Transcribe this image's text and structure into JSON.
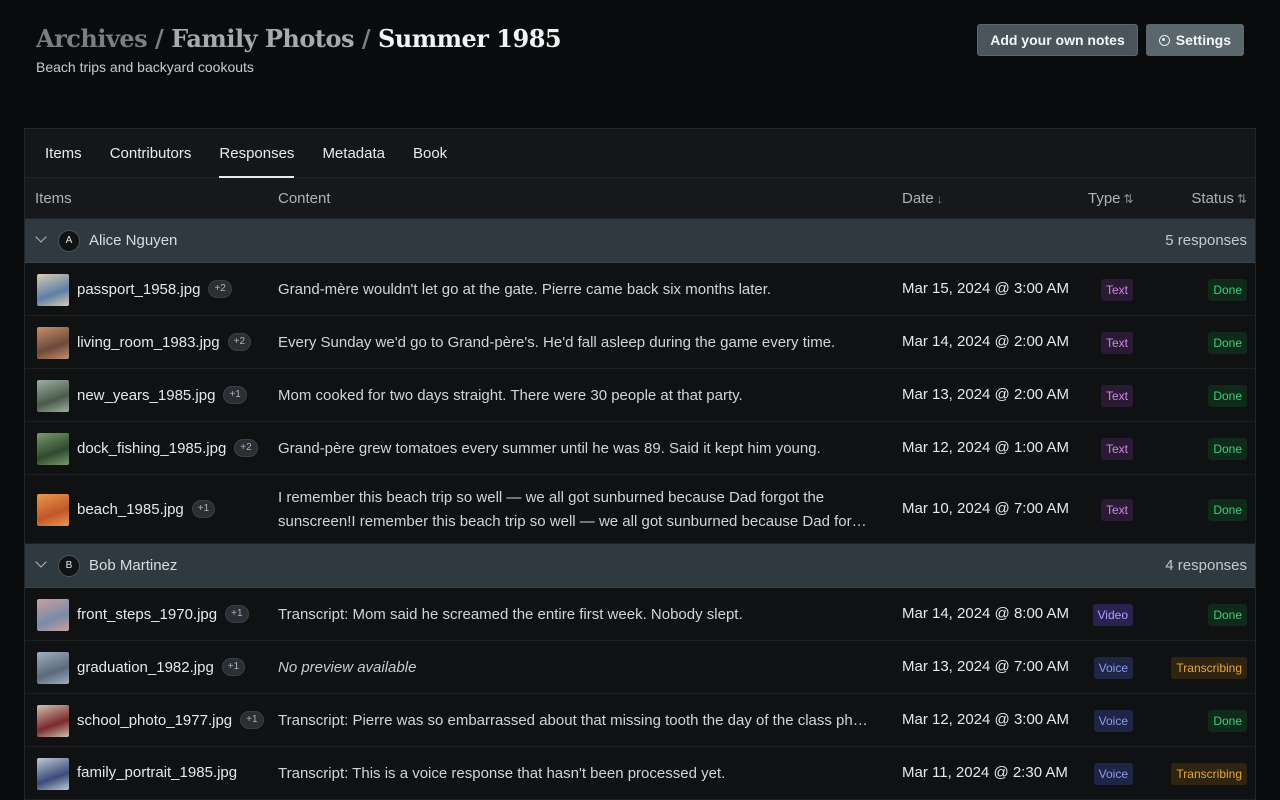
{
  "breadcrumb": {
    "part1": "Archives",
    "part2": "Family Photos",
    "current": "Summer 1985",
    "separator": "/"
  },
  "subtitle": "Beach trips and backyard cookouts",
  "actions": {
    "notes": "Add your own notes",
    "settings": "Settings"
  },
  "tabs": [
    "Items",
    "Contributors",
    "Responses",
    "Metadata",
    "Book"
  ],
  "active_tab": "Responses",
  "columns": {
    "items": "Items",
    "content": "Content",
    "date": "Date",
    "type": "Type",
    "status": "Status"
  },
  "groups": [
    {
      "initial": "A",
      "name": "Alice Nguyen",
      "count": "5 responses",
      "rows": [
        {
          "file": "passport_1958.jpg",
          "extra": "+2",
          "content": "Grand-mère wouldn't let go at the gate. Pierre came back six months later.",
          "date": "Mar 15, 2024 @ 3:00 AM",
          "type": "Text",
          "status": "Done"
        },
        {
          "file": "living_room_1983.jpg",
          "extra": "+2",
          "content": "Every Sunday we'd go to Grand-père's. He'd fall asleep during the game every time.",
          "date": "Mar 14, 2024 @ 2:00 AM",
          "type": "Text",
          "status": "Done"
        },
        {
          "file": "new_years_1985.jpg",
          "extra": "+1",
          "content": "Mom cooked for two days straight. There were 30 people at that party.",
          "date": "Mar 13, 2024 @ 2:00 AM",
          "type": "Text",
          "status": "Done"
        },
        {
          "file": "dock_fishing_1985.jpg",
          "extra": "+2",
          "content": "Grand-père grew tomatoes every summer until he was 89. Said it kept him young.",
          "date": "Mar 12, 2024 @ 1:00 AM",
          "type": "Text",
          "status": "Done"
        },
        {
          "file": "beach_1985.jpg",
          "extra": "+1",
          "content": "I remember this beach trip so well — we all got sunburned because Dad forgot the sunscreen!I remember this beach trip so well — we all got sunburned because Dad forgot the sunscreen!",
          "date": "Mar 10, 2024 @ 7:00 AM",
          "type": "Text",
          "status": "Done"
        }
      ]
    },
    {
      "initial": "B",
      "name": "Bob Martinez",
      "count": "4 responses",
      "rows": [
        {
          "file": "front_steps_1970.jpg",
          "extra": "+1",
          "content": "Transcript: Mom said he screamed the entire first week. Nobody slept.",
          "date": "Mar 14, 2024 @ 8:00 AM",
          "type": "Video",
          "status": "Done"
        },
        {
          "file": "graduation_1982.jpg",
          "extra": "+1",
          "content": "No preview available",
          "date": "Mar 13, 2024 @ 7:00 AM",
          "type": "Voice",
          "status": "Transcribing"
        },
        {
          "file": "school_photo_1977.jpg",
          "extra": "+1",
          "content": "Transcript: Pierre was so embarrassed about that missing tooth the day of the class photo.",
          "date": "Mar 12, 2024 @ 3:00 AM",
          "type": "Voice",
          "status": "Done"
        },
        {
          "file": "family_portrait_1985.jpg",
          "extra": "",
          "content": "Transcript: This is a voice response that hasn't been processed yet.",
          "date": "Mar 11, 2024 @ 2:30 AM",
          "type": "Voice",
          "status": "Transcribing"
        }
      ]
    }
  ],
  "icons": {
    "settings": "gear-icon",
    "group_toggle": "chevron-down-icon",
    "sort_date": "arrow-down-icon",
    "sort_type": "sort-icon",
    "sort_status": "sort-icon"
  }
}
